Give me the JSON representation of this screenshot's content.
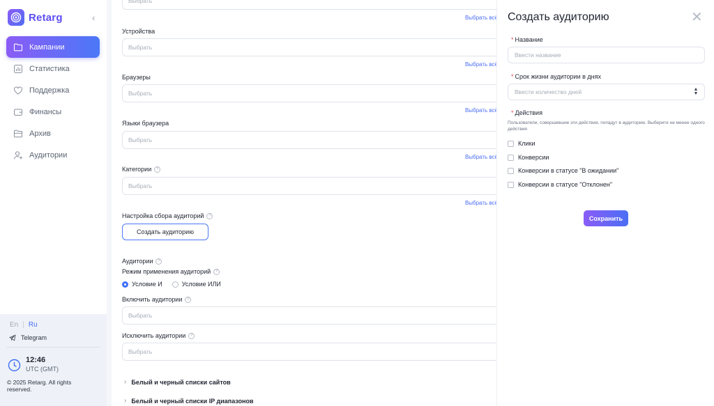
{
  "brand": {
    "name": "Retarg",
    "accent": "#5d4ef0"
  },
  "sidebar": {
    "items": [
      {
        "label": "Кампании",
        "icon": "folder-icon",
        "active": true
      },
      {
        "label": "Статистика",
        "icon": "chart-icon",
        "active": false
      },
      {
        "label": "Поддержка",
        "icon": "heart-icon",
        "active": false
      },
      {
        "label": "Финансы",
        "icon": "wallet-icon",
        "active": false
      },
      {
        "label": "Архив",
        "icon": "archive-icon",
        "active": false
      },
      {
        "label": "Аудитории",
        "icon": "add-user-icon",
        "active": false
      }
    ],
    "lang_en": "En",
    "lang_ru": "Ru",
    "telegram": "Telegram",
    "time": "12:46",
    "timezone": "UTC (GMT)",
    "copyright": "© 2025 Retarg. All rights reserved."
  },
  "form": {
    "select_placeholder": "Выбрать",
    "select_all": "Выбрать всё",
    "devices_label": "Устройства",
    "browsers_label": "Браузеры",
    "browser_languages_label": "Языки браузера",
    "categories_label": "Категории",
    "audience_setup_label": "Настройка сбора аудиторий",
    "create_audience_button": "Создать аудиторию",
    "audiences_label": "Аудитории",
    "mode_label": "Режим применения аудиторий",
    "condition_and": "Условие И",
    "condition_or": "Условие ИЛИ",
    "include_label": "Включить аудитории",
    "exclude_label": "Исключить аудитории",
    "sites_list": "Белый и черный списки сайтов",
    "ip_list": "Белый и черный списки IP диапазонов"
  },
  "panel": {
    "title": "Создать аудиторию",
    "name_label": "Название",
    "name_placeholder": "Ввести название",
    "lifetime_label": "Срок жизни аудитории в днях",
    "lifetime_placeholder": "Ввести количество дней",
    "actions_label": "Действия",
    "actions_hint": "Пользователи, совершившие эти действия, попадут в аудиторию. Выберите не менее одного действия",
    "options": [
      "Клики",
      "Конверсии",
      "Конверсии в статусе \"В ожидании\"",
      "Конверсии в статусе \"Отклонен\""
    ],
    "save_button": "Сохранить"
  }
}
